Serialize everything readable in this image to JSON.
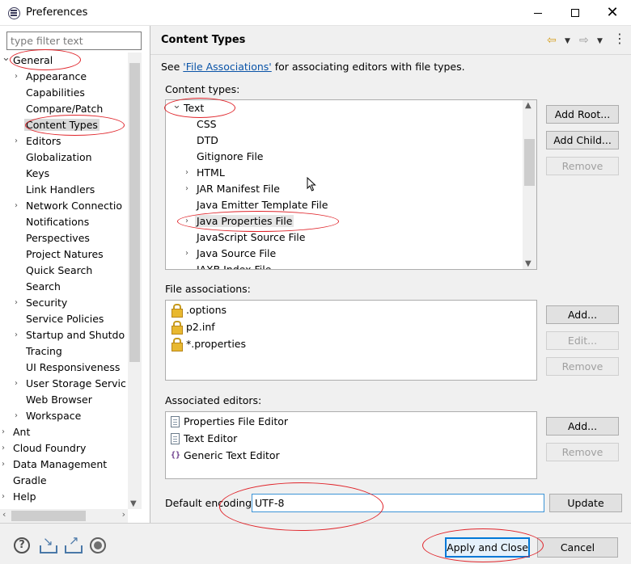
{
  "window": {
    "title": "Preferences"
  },
  "filter": {
    "placeholder": "type filter text"
  },
  "tree": {
    "items": [
      {
        "label": "General",
        "level": 0,
        "twisty": "open"
      },
      {
        "label": "Appearance",
        "level": 1,
        "twisty": "closed"
      },
      {
        "label": "Capabilities",
        "level": 1,
        "twisty": "none"
      },
      {
        "label": "Compare/Patch",
        "level": 1,
        "twisty": "none"
      },
      {
        "label": "Content Types",
        "level": 1,
        "twisty": "none",
        "selected": true
      },
      {
        "label": "Editors",
        "level": 1,
        "twisty": "closed"
      },
      {
        "label": "Globalization",
        "level": 1,
        "twisty": "none"
      },
      {
        "label": "Keys",
        "level": 1,
        "twisty": "none"
      },
      {
        "label": "Link Handlers",
        "level": 1,
        "twisty": "none"
      },
      {
        "label": "Network Connectio",
        "level": 1,
        "twisty": "closed"
      },
      {
        "label": "Notifications",
        "level": 1,
        "twisty": "none"
      },
      {
        "label": "Perspectives",
        "level": 1,
        "twisty": "none"
      },
      {
        "label": "Project Natures",
        "level": 1,
        "twisty": "none"
      },
      {
        "label": "Quick Search",
        "level": 1,
        "twisty": "none"
      },
      {
        "label": "Search",
        "level": 1,
        "twisty": "none"
      },
      {
        "label": "Security",
        "level": 1,
        "twisty": "closed"
      },
      {
        "label": "Service Policies",
        "level": 1,
        "twisty": "none"
      },
      {
        "label": "Startup and Shutdo",
        "level": 1,
        "twisty": "closed"
      },
      {
        "label": "Tracing",
        "level": 1,
        "twisty": "none"
      },
      {
        "label": "UI Responsiveness",
        "level": 1,
        "twisty": "none"
      },
      {
        "label": "User Storage Servic",
        "level": 1,
        "twisty": "closed"
      },
      {
        "label": "Web Browser",
        "level": 1,
        "twisty": "none"
      },
      {
        "label": "Workspace",
        "level": 1,
        "twisty": "closed"
      },
      {
        "label": "Ant",
        "level": 0,
        "twisty": "closed"
      },
      {
        "label": "Cloud Foundry",
        "level": 0,
        "twisty": "closed"
      },
      {
        "label": "Data Management",
        "level": 0,
        "twisty": "closed"
      },
      {
        "label": "Gradle",
        "level": 0,
        "twisty": "none"
      },
      {
        "label": "Help",
        "level": 0,
        "twisty": "closed"
      }
    ]
  },
  "header": {
    "title": "Content Types"
  },
  "see_line": {
    "prefix": "See ",
    "link": "'File Associations'",
    "suffix": " for associating editors with file types."
  },
  "content_types": {
    "label": "Content types:",
    "items": [
      {
        "label": "Text",
        "level": 0,
        "twisty": "open"
      },
      {
        "label": "CSS",
        "level": 1,
        "twisty": "none"
      },
      {
        "label": "DTD",
        "level": 1,
        "twisty": "none"
      },
      {
        "label": "Gitignore File",
        "level": 1,
        "twisty": "none"
      },
      {
        "label": "HTML",
        "level": 1,
        "twisty": "closed"
      },
      {
        "label": "JAR Manifest File",
        "level": 1,
        "twisty": "closed"
      },
      {
        "label": "Java Emitter Template File",
        "level": 1,
        "twisty": "none"
      },
      {
        "label": "Java Properties File",
        "level": 1,
        "twisty": "closed",
        "selected": true
      },
      {
        "label": "JavaScript Source File",
        "level": 1,
        "twisty": "none"
      },
      {
        "label": "Java Source File",
        "level": 1,
        "twisty": "closed"
      },
      {
        "label": "JAXB Index File",
        "level": 1,
        "twisty": "none"
      }
    ],
    "buttons": {
      "add_root": "Add Root...",
      "add_child": "Add Child...",
      "remove": "Remove"
    }
  },
  "file_associations": {
    "label": "File associations:",
    "items": [
      ".options",
      "p2.inf",
      "*.properties"
    ],
    "buttons": {
      "add": "Add...",
      "edit": "Edit...",
      "remove": "Remove"
    }
  },
  "associated_editors": {
    "label": "Associated editors:",
    "items": [
      {
        "label": "Properties File Editor",
        "icon": "document-icon"
      },
      {
        "label": "Text Editor",
        "icon": "document-icon"
      },
      {
        "label": "Generic Text Editor",
        "icon": "braces-icon"
      }
    ],
    "buttons": {
      "add": "Add...",
      "remove": "Remove"
    }
  },
  "encoding": {
    "label": "Default encoding:",
    "value": "UTF-8",
    "update": "Update"
  },
  "footer": {
    "apply_close": "Apply and Close",
    "cancel": "Cancel"
  },
  "annotation_color": "#e0242a"
}
